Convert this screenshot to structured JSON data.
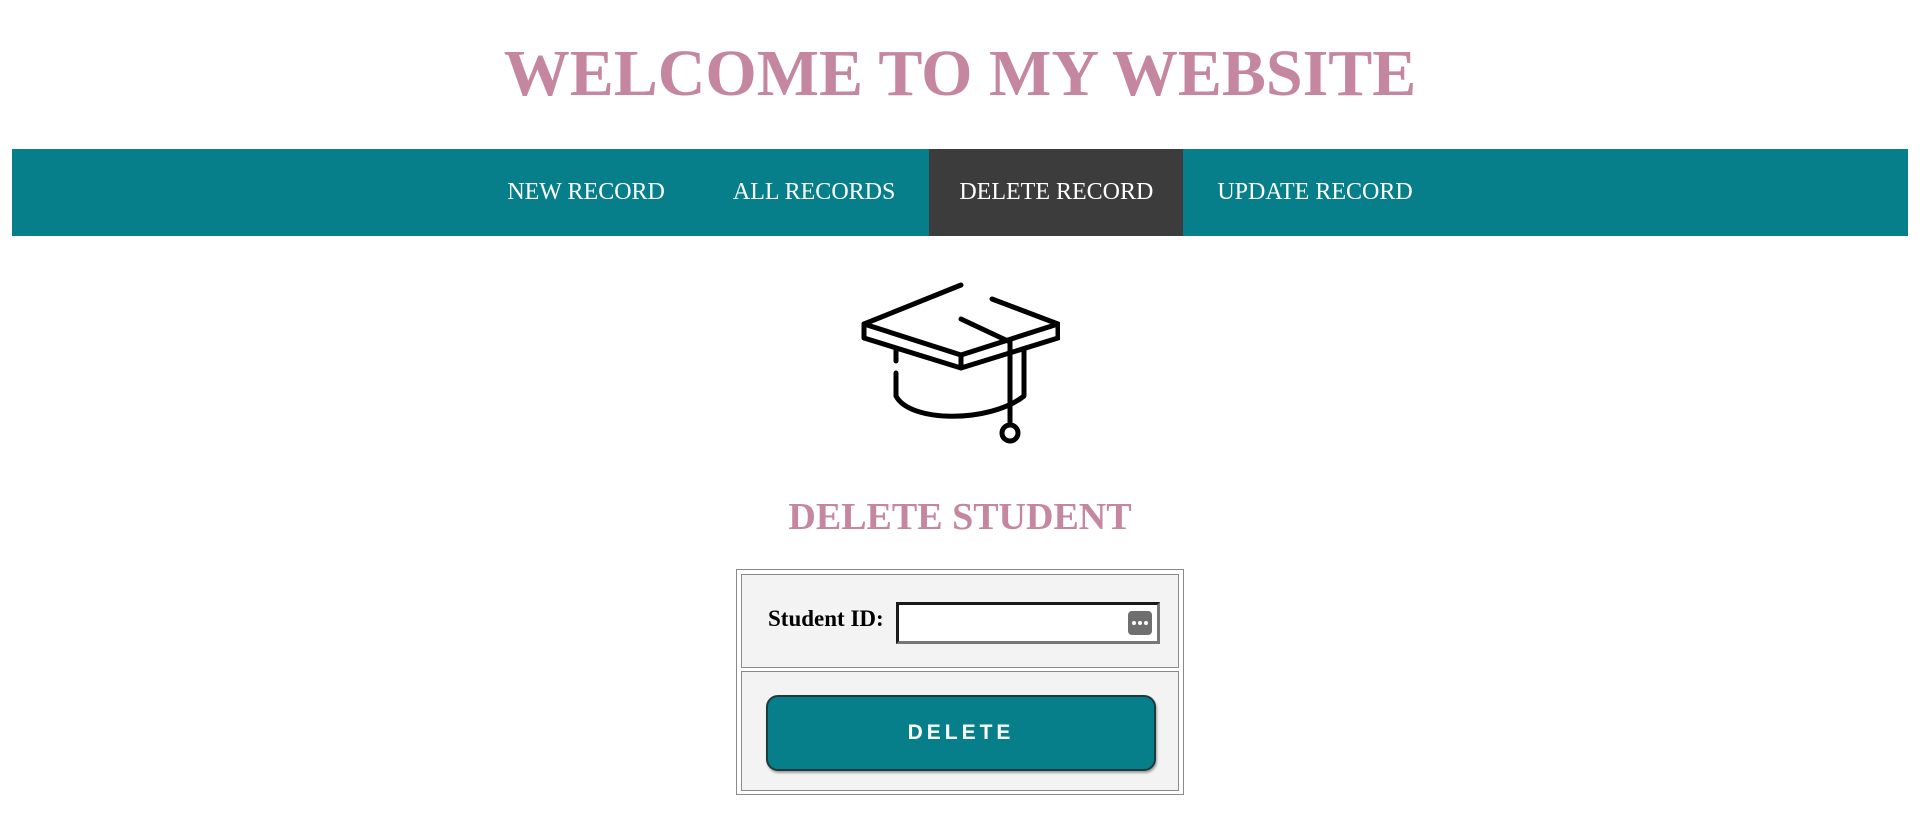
{
  "header": {
    "title": "WELCOME TO MY WEBSITE"
  },
  "nav": {
    "items": [
      {
        "label": "NEW RECORD",
        "active": false
      },
      {
        "label": "ALL RECORDS",
        "active": false
      },
      {
        "label": "DELETE RECORD",
        "active": true
      },
      {
        "label": "UPDATE RECORD",
        "active": false
      }
    ]
  },
  "main": {
    "icon": "graduation-cap-icon",
    "section_title": "DELETE STUDENT",
    "form": {
      "id_label": "Student ID:",
      "id_value": "",
      "id_placeholder": "",
      "input_badge_icon": "more-dots-icon",
      "submit_label": "DELETE"
    }
  },
  "colors": {
    "title": "#c5879f",
    "nav_bg": "#077f8b",
    "nav_active_bg": "#3c3c3c",
    "button_bg": "#077f8b",
    "form_bg": "#f3f3f3"
  }
}
